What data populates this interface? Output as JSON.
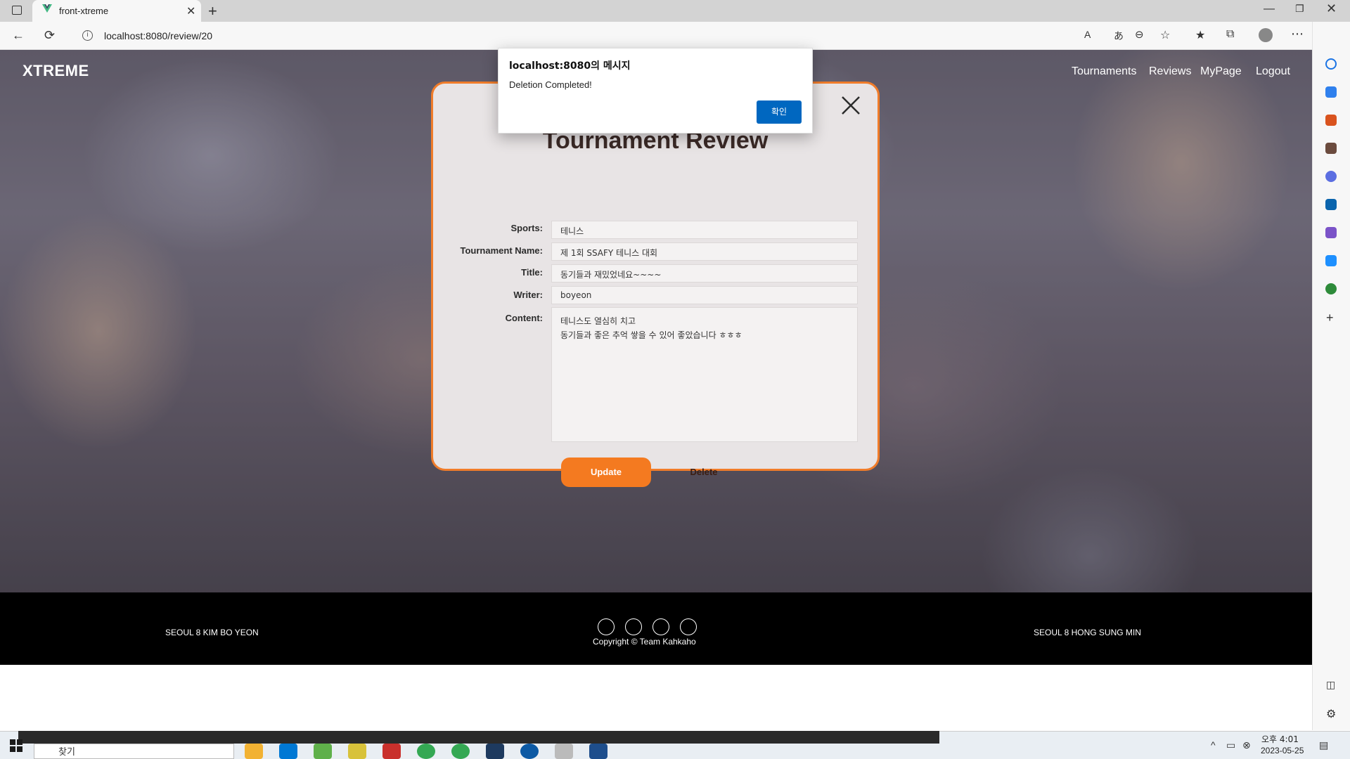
{
  "browser": {
    "tab_title": "front-xtreme",
    "url": "localhost:8080/review/20"
  },
  "nav": {
    "brand": "XTREME",
    "menu": [
      "Tournaments",
      "Reviews",
      "MyPage",
      "Logout"
    ]
  },
  "modal": {
    "title": "Tournament Review",
    "fields": {
      "sports_label": "Sports:",
      "sports_value": "테니스",
      "tournament_label": "Tournament Name:",
      "tournament_value": "제 1회 SSAFY 테니스 대회",
      "title_label": "Title:",
      "title_value": "동기들과 재밌었네요~~~~",
      "writer_label": "Writer:",
      "writer_value": "boyeon",
      "content_label": "Content:",
      "content_value": "테니스도 열심히 치고\n동기들과 좋은 추억 쌓을 수 있어 좋았습니다 ㅎㅎㅎ"
    },
    "update_label": "Update",
    "delete_label": "Delete",
    "accent_color": "#f47a20"
  },
  "dialog": {
    "title": "localhost:8080의 메시지",
    "message": "Deletion Completed!",
    "ok_label": "확인"
  },
  "footer": {
    "left": "SEOUL 8 KIM BO YEON",
    "right": "SEOUL 8 HONG SUNG MIN",
    "copyright": "Copyright © Team Kahkaho",
    "icons": [
      "github-icon",
      "github-icon",
      "mail-icon",
      "mail-icon"
    ]
  },
  "taskbar": {
    "search_placeholder": "찾기",
    "time": "오후 4:01",
    "date": "2023-05-25"
  }
}
